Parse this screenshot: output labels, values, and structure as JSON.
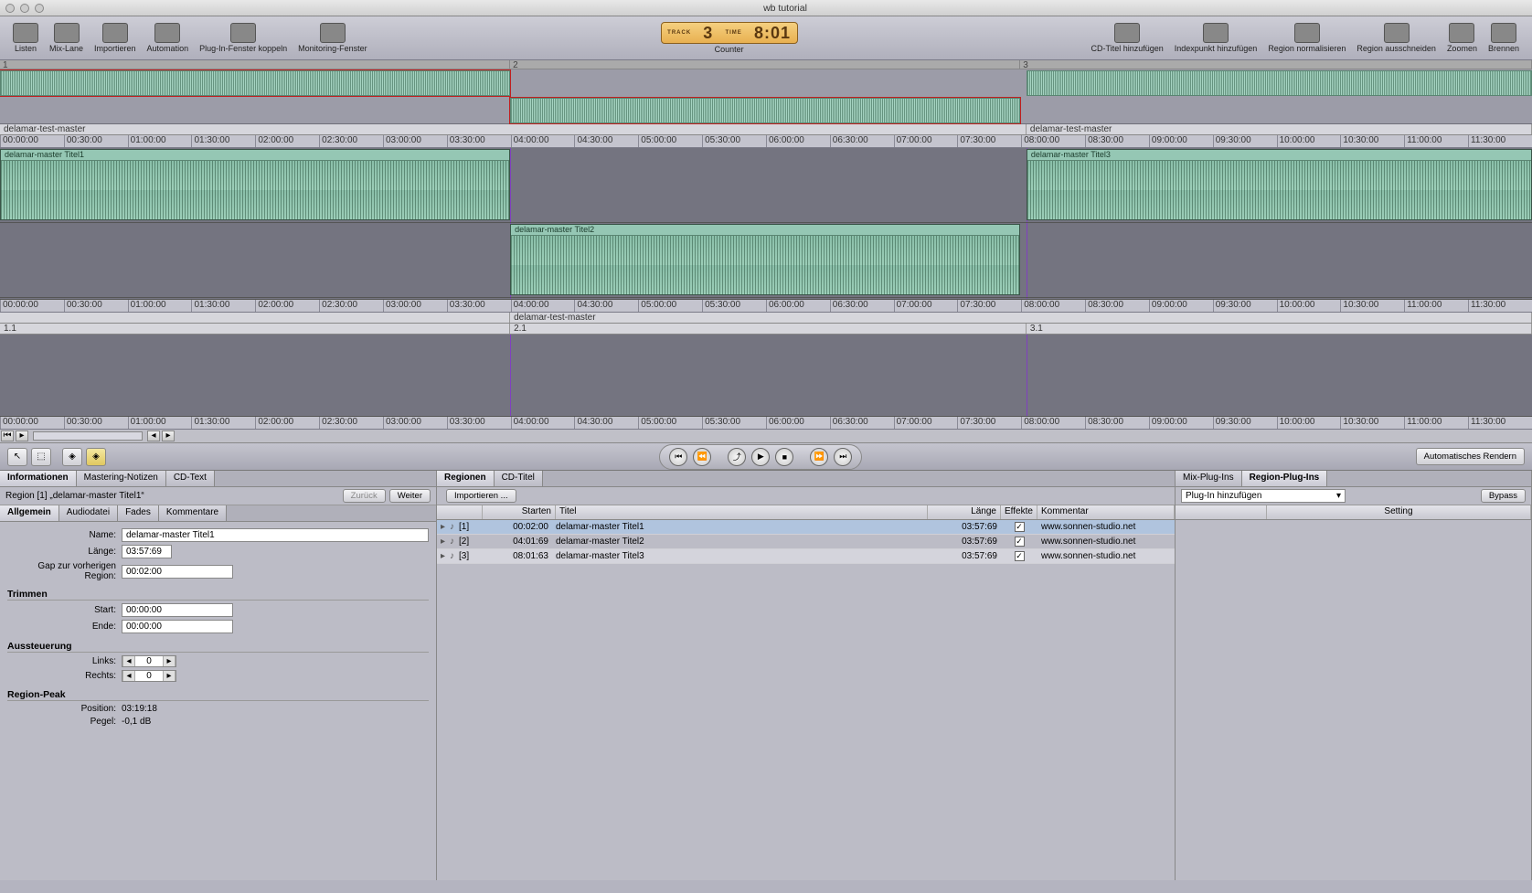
{
  "window_title": "wb tutorial",
  "toolbar_left": [
    {
      "label": "Listen"
    },
    {
      "label": "Mix-Lane"
    },
    {
      "label": "Importieren"
    },
    {
      "label": "Automation"
    },
    {
      "label": "Plug-In-Fenster koppeln"
    },
    {
      "label": "Monitoring-Fenster"
    }
  ],
  "toolbar_right": [
    {
      "label": "CD-Titel hinzufügen"
    },
    {
      "label": "Indexpunkt hinzufügen"
    },
    {
      "label": "Region normalisieren"
    },
    {
      "label": "Region ausschneiden"
    },
    {
      "label": "Zoomen"
    },
    {
      "label": "Brennen"
    }
  ],
  "counter": {
    "label": "Counter",
    "track_lbl": "TRACK",
    "track": "3",
    "time_lbl": "TIME",
    "time": "8:01"
  },
  "overview_numbers": [
    "1",
    "2",
    "3"
  ],
  "region_labels": [
    "delamar-test-master",
    "delamar-test-master"
  ],
  "ruler_times": [
    "00:00:00",
    "00:30:00",
    "01:00:00",
    "01:30:00",
    "02:00:00",
    "02:30:00",
    "03:00:00",
    "03:30:00",
    "04:00:00",
    "04:30:00",
    "05:00:00",
    "05:30:00",
    "06:00:00",
    "06:30:00",
    "07:00:00",
    "07:30:00",
    "08:00:00",
    "08:30:00",
    "09:00:00",
    "09:30:00",
    "10:00:00",
    "10:30:00",
    "11:00:00",
    "11:30:00"
  ],
  "clips": {
    "a": "delamar-master Titel1",
    "b": "delamar-master Titel2",
    "c": "delamar-master Titel3"
  },
  "marker_region": "delamar-test-master",
  "marker_nums": [
    "1.1",
    "2.1",
    "3.1"
  ],
  "auto_render": "Automatisches Rendern",
  "left_tabs": [
    "Informationen",
    "Mastering-Notizen",
    "CD-Text"
  ],
  "left_sub": "Region [1] „delamar-master Titel1“",
  "nav": {
    "back": "Zurück",
    "fwd": "Weiter"
  },
  "left_inner_tabs": [
    "Allgemein",
    "Audiodatei",
    "Fades",
    "Kommentare"
  ],
  "form": {
    "name_lbl": "Name:",
    "name": "delamar-master Titel1",
    "len_lbl": "Länge:",
    "len": "03:57:69",
    "gap_lbl": "Gap zur vorherigen Region:",
    "gap": "00:02:00",
    "trim_hdr": "Trimmen",
    "start_lbl": "Start:",
    "start": "00:00:00",
    "end_lbl": "Ende:",
    "end": "00:00:00",
    "aus_hdr": "Aussteuerung",
    "links_lbl": "Links:",
    "links": "0",
    "rechts_lbl": "Rechts:",
    "rechts": "0",
    "peak_hdr": "Region-Peak",
    "pos_lbl": "Position:",
    "pos": "03:19:18",
    "peg_lbl": "Pegel:",
    "peg": "-0,1 dB"
  },
  "mid_tabs": [
    "Regionen",
    "CD-Titel"
  ],
  "mid_import": "Importieren ...",
  "mid_cols": {
    "start": "Starten",
    "titel": "Titel",
    "len": "Länge",
    "fx": "Effekte",
    "kom": "Kommentar"
  },
  "regions": [
    {
      "idx": "[1]",
      "start": "00:02:00",
      "titel": "delamar-master Titel1",
      "len": "03:57:69",
      "fx": true,
      "kom": "www.sonnen-studio.net"
    },
    {
      "idx": "[2]",
      "start": "04:01:69",
      "titel": "delamar-master Titel2",
      "len": "03:57:69",
      "fx": true,
      "kom": "www.sonnen-studio.net"
    },
    {
      "idx": "[3]",
      "start": "08:01:63",
      "titel": "delamar-master Titel3",
      "len": "03:57:69",
      "fx": true,
      "kom": "www.sonnen-studio.net"
    }
  ],
  "right_tabs": [
    "Mix-Plug-Ins",
    "Region-Plug-Ins"
  ],
  "right_select": "Plug-In hinzufügen",
  "right_bypass": "Bypass",
  "right_col": "Setting"
}
